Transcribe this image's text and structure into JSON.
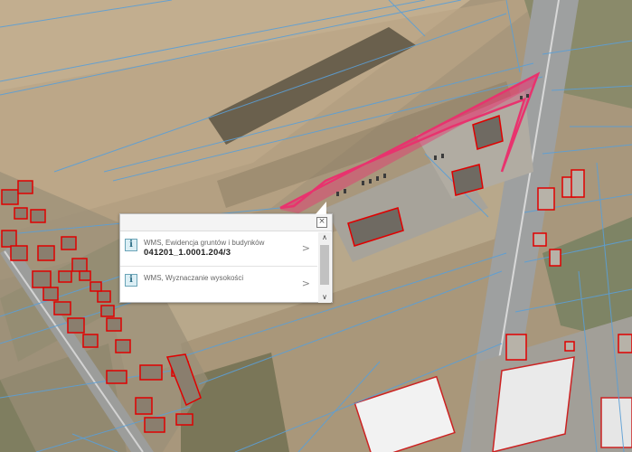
{
  "popup": {
    "close_symbol": "×",
    "items": [
      {
        "icon": "i",
        "title": "WMS, Ewidencja gruntów i budynków",
        "value": "041201_1.0001.204/3",
        "chevron": ">"
      },
      {
        "icon": "i",
        "title": "WMS, Wyznaczanie wysokości",
        "value": "",
        "chevron": ">"
      }
    ],
    "scroll_up_symbol": "∧",
    "scroll_down_symbol": "∨"
  },
  "colors": {
    "parcel_lines": "#5b9fd6",
    "building_outline": "#e00000",
    "selected_parcel": "#e8336e",
    "field": "#bda786",
    "popup_bg": "#ffffff"
  }
}
